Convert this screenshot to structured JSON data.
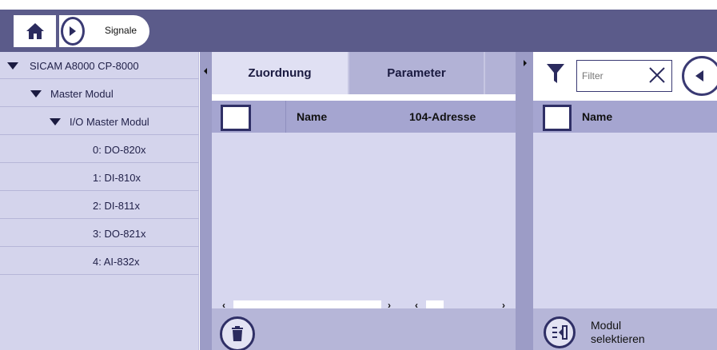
{
  "topbar": {
    "title": "Signale",
    "home_icon": "home-icon",
    "nav_icon": "chevron-right-icon",
    "colors": {
      "bar": "#5b5b8a",
      "accent": "#3a3a73"
    }
  },
  "tree": {
    "items": [
      {
        "label": "SICAM A8000 CP-8000",
        "expanded": true
      },
      {
        "label": "Master Modul",
        "expanded": true
      },
      {
        "label": "I/O Master Modul",
        "expanded": true
      },
      {
        "label": "0: DO-820x"
      },
      {
        "label": "1: DI-810x"
      },
      {
        "label": "2: DI-811x"
      },
      {
        "label": "3: DO-821x"
      },
      {
        "label": "4: AI-832x"
      }
    ]
  },
  "middle": {
    "tabs": [
      {
        "label": "Zuordnung",
        "active": true
      },
      {
        "label": "Parameter",
        "active": false
      }
    ],
    "columns": [
      {
        "label": "Name"
      },
      {
        "label": "104-Adresse"
      }
    ],
    "footer_icon": "trash-icon"
  },
  "right": {
    "filter": {
      "placeholder": "Filter",
      "value": ""
    },
    "columns": [
      {
        "label": "Name"
      }
    ],
    "footer_button": {
      "label_line1": "Modul",
      "label_line2": "selektieren",
      "icon": "select-module-icon"
    }
  }
}
